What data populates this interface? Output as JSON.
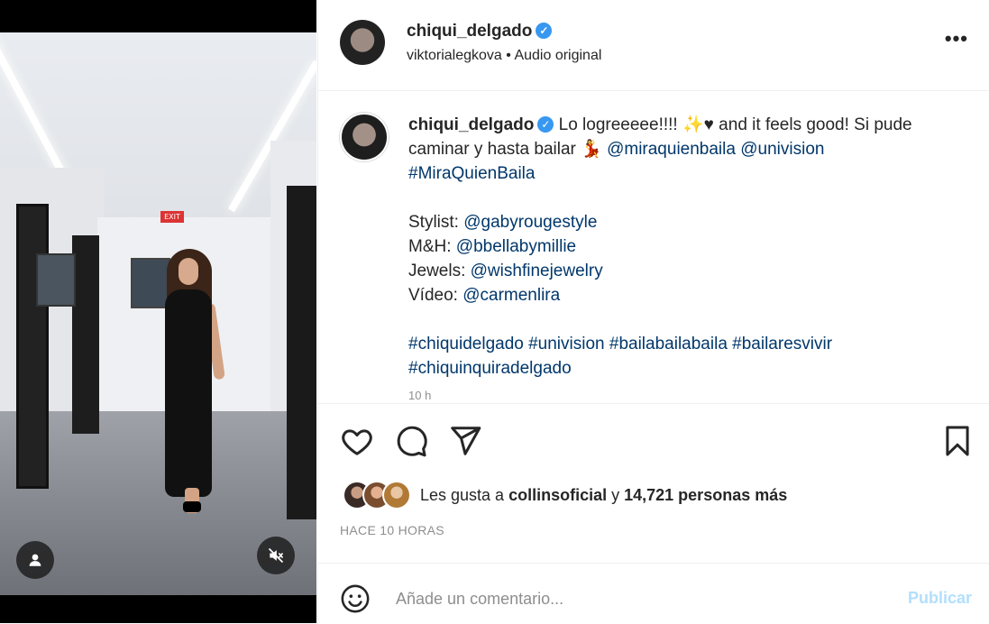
{
  "post": {
    "username": "chiqui_delgado",
    "audio_user": "viktorialegkova",
    "audio_separator": "•",
    "audio_label": "Audio original",
    "more_glyph": "•••"
  },
  "video": {
    "exit_sign": "EXIT"
  },
  "caption": {
    "username": "chiqui_delgado",
    "line1_text": "Lo logreeeee!!!! ✨♥ and it feels good! Si pude caminar y hasta bailar 💃 ",
    "mention1": "@miraquienbaila",
    "mention2": "@univision",
    "hashtag1": "#MiraQuienBaila",
    "stylist_label": "Stylist: ",
    "stylist_mention": "@gabyrougestyle",
    "mh_label": "M&H: ",
    "mh_mention": "@bbellabymillie",
    "jewels_label": "Jewels: ",
    "jewels_mention": "@wishfinejewelry",
    "video_label": "Vídeo: ",
    "video_mention": "@carmenlira",
    "tags_line1": "#chiquidelgado #univision #bailabailabaila #bailaresvivir",
    "tags_line2": "#chiquinquiradelgado",
    "time_cut": "10 h"
  },
  "likes": {
    "prefix": "Les gusta a ",
    "user": "collinsoficial",
    "middle": " y ",
    "count": "14,721 personas más"
  },
  "posted": "HACE 10 HORAS",
  "comment": {
    "placeholder": "Añade un comentario...",
    "publish": "Publicar"
  },
  "icons": {
    "like": "heart-icon",
    "comment": "comment-icon",
    "share": "share-icon",
    "save": "bookmark-icon",
    "emoji": "smiley-icon",
    "user": "user-icon",
    "mute": "muted-speaker-icon",
    "verified": "verified-badge-icon"
  },
  "colors": {
    "link": "#00376b",
    "verified": "#3897f0",
    "publish_disabled": "#b2dffc",
    "muted_text": "#8e8e8e"
  }
}
